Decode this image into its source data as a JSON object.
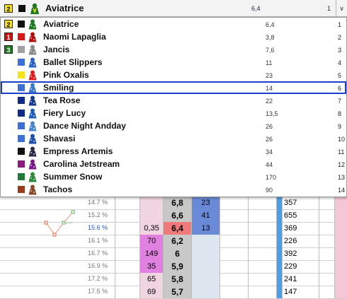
{
  "combo": {
    "number": "2",
    "number_bg": "#f6e020",
    "color": "#111111",
    "silk_icon": "horse-silk-icon",
    "name": "Aviatrice",
    "odds": "6,4",
    "position": "1"
  },
  "runners": [
    {
      "number": "2",
      "number_bg": "#f6e020",
      "number_fg": "#000000",
      "color": "#111111",
      "silk": "#1e7a1e",
      "name": "Aviatrice",
      "odds": "6,4",
      "position": "1"
    },
    {
      "number": "1",
      "number_bg": "#cc1111",
      "number_fg": "#ffffff",
      "color": "#d81818",
      "silk": "#b01010",
      "name": "Naomi Lapaglia",
      "odds": "3,8",
      "position": "2"
    },
    {
      "number": "3",
      "number_bg": "#1e7a1e",
      "number_fg": "#ffffff",
      "color": "#a0a0a0",
      "silk": "#8a8a8a",
      "name": "Jancis",
      "odds": "7,6",
      "position": "3"
    },
    {
      "number": "",
      "number_bg": "",
      "number_fg": "",
      "color": "#3d6fd6",
      "silk": "#2a62c8",
      "name": "Ballet Slippers",
      "odds": "11",
      "position": "4"
    },
    {
      "number": "",
      "number_bg": "",
      "number_fg": "",
      "color": "#f4e21c",
      "silk": "#e02020",
      "name": "Pink Oxalis",
      "odds": "23",
      "position": "5"
    },
    {
      "number": "",
      "number_bg": "",
      "number_fg": "",
      "color": "#3d6fd6",
      "silk": "#3a78c8",
      "name": "Smiling",
      "odds": "14",
      "position": "6"
    },
    {
      "number": "",
      "number_bg": "",
      "number_fg": "",
      "color": "#112a8a",
      "silk": "#123a88",
      "name": "Tea Rose",
      "odds": "22",
      "position": "7"
    },
    {
      "number": "",
      "number_bg": "",
      "number_fg": "",
      "color": "#112a8a",
      "silk": "#1e5fb8",
      "name": "Fiery Lucy",
      "odds": "13,5",
      "position": "8"
    },
    {
      "number": "",
      "number_bg": "",
      "number_fg": "",
      "color": "#3d6fd6",
      "silk": "#4a86d0",
      "name": "Dance Night Andday",
      "odds": "26",
      "position": "9"
    },
    {
      "number": "",
      "number_bg": "",
      "number_fg": "",
      "color": "#3d6fd6",
      "silk": "#1c4fa8",
      "name": "Shavasi",
      "odds": "26",
      "position": "10"
    },
    {
      "number": "",
      "number_bg": "",
      "number_fg": "",
      "color": "#111111",
      "silk": "#2a2a4a",
      "name": "Empress Artemis",
      "odds": "34",
      "position": "11"
    },
    {
      "number": "",
      "number_bg": "",
      "number_fg": "",
      "color": "#8a1a7a",
      "silk": "#7a1a8a",
      "name": "Carolina Jetstream",
      "odds": "44",
      "position": "12"
    },
    {
      "number": "",
      "number_bg": "",
      "number_fg": "",
      "color": "#1e7a3a",
      "silk": "#2a8a3a",
      "name": "Summer Snow",
      "odds": "170",
      "position": "13"
    },
    {
      "number": "",
      "number_bg": "",
      "number_fg": "",
      "color": "#9a3a1a",
      "silk": "#8a4a2a",
      "name": "Tachos",
      "odds": "90",
      "position": "14"
    }
  ],
  "selected_runner": "Smiling",
  "background_table": [
    {
      "pct": "14.7 %",
      "c1": "",
      "c2": "",
      "c3": "6,8",
      "c4": "23",
      "c5": "",
      "c6": "",
      "c8": "357",
      "c1_bg": "",
      "c2_bg": "#f0d4e0",
      "c3_bg": "#c8c8c8",
      "c4_bg": "#6a8ad8"
    },
    {
      "pct": "15.2 %",
      "c1": "",
      "c2": "",
      "c3": "6,6",
      "c4": "41",
      "c5": "",
      "c6": "",
      "c8": "655",
      "c1_bg": "",
      "c2_bg": "#f0d4e0",
      "c3_bg": "#c8c8c8",
      "c4_bg": "#6a8ad8"
    },
    {
      "pct": "15.6 %",
      "c1": "",
      "c2": "0,35",
      "c3": "6,4",
      "c4": "13",
      "c5": "",
      "c6": "",
      "c8": "369",
      "c1_bg": "",
      "c2_bg": "#f0d4e0",
      "c3_bg": "#f07a7a",
      "c4_bg": "#6a8ad8"
    },
    {
      "pct": "16.1 %",
      "c1": "",
      "c2": "70",
      "c3": "6,2",
      "c4": "",
      "c5": "",
      "c6": "",
      "c8": "226",
      "c1_bg": "",
      "c2_bg": "#e080e0",
      "c3_bg": "#c8c8c8",
      "c4_bg": "#dde6ee"
    },
    {
      "pct": "16.7 %",
      "c1": "",
      "c2": "149",
      "c3": "6",
      "c4": "",
      "c5": "",
      "c6": "",
      "c8": "392",
      "c1_bg": "",
      "c2_bg": "#e080e0",
      "c3_bg": "#c8c8c8",
      "c4_bg": "#dde6ee"
    },
    {
      "pct": "16.9 %",
      "c1": "",
      "c2": "35",
      "c3": "5,9",
      "c4": "",
      "c5": "",
      "c6": "",
      "c8": "229",
      "c1_bg": "",
      "c2_bg": "#e080e0",
      "c3_bg": "#c8c8c8",
      "c4_bg": "#dde6ee"
    },
    {
      "pct": "17.2 %",
      "c1": "",
      "c2": "65",
      "c3": "5,8",
      "c4": "",
      "c5": "",
      "c6": "",
      "c8": "241",
      "c1_bg": "",
      "c2_bg": "#f0d4e0",
      "c3_bg": "#c8c8c8",
      "c4_bg": "#dde6ee"
    },
    {
      "pct": "17.5 %",
      "c1": "",
      "c2": "69",
      "c3": "5,7",
      "c4": "",
      "c5": "",
      "c6": "",
      "c8": "147",
      "c1_bg": "",
      "c2_bg": "#f0d4e0",
      "c3_bg": "#c8c8c8",
      "c4_bg": "#dde6ee"
    }
  ]
}
